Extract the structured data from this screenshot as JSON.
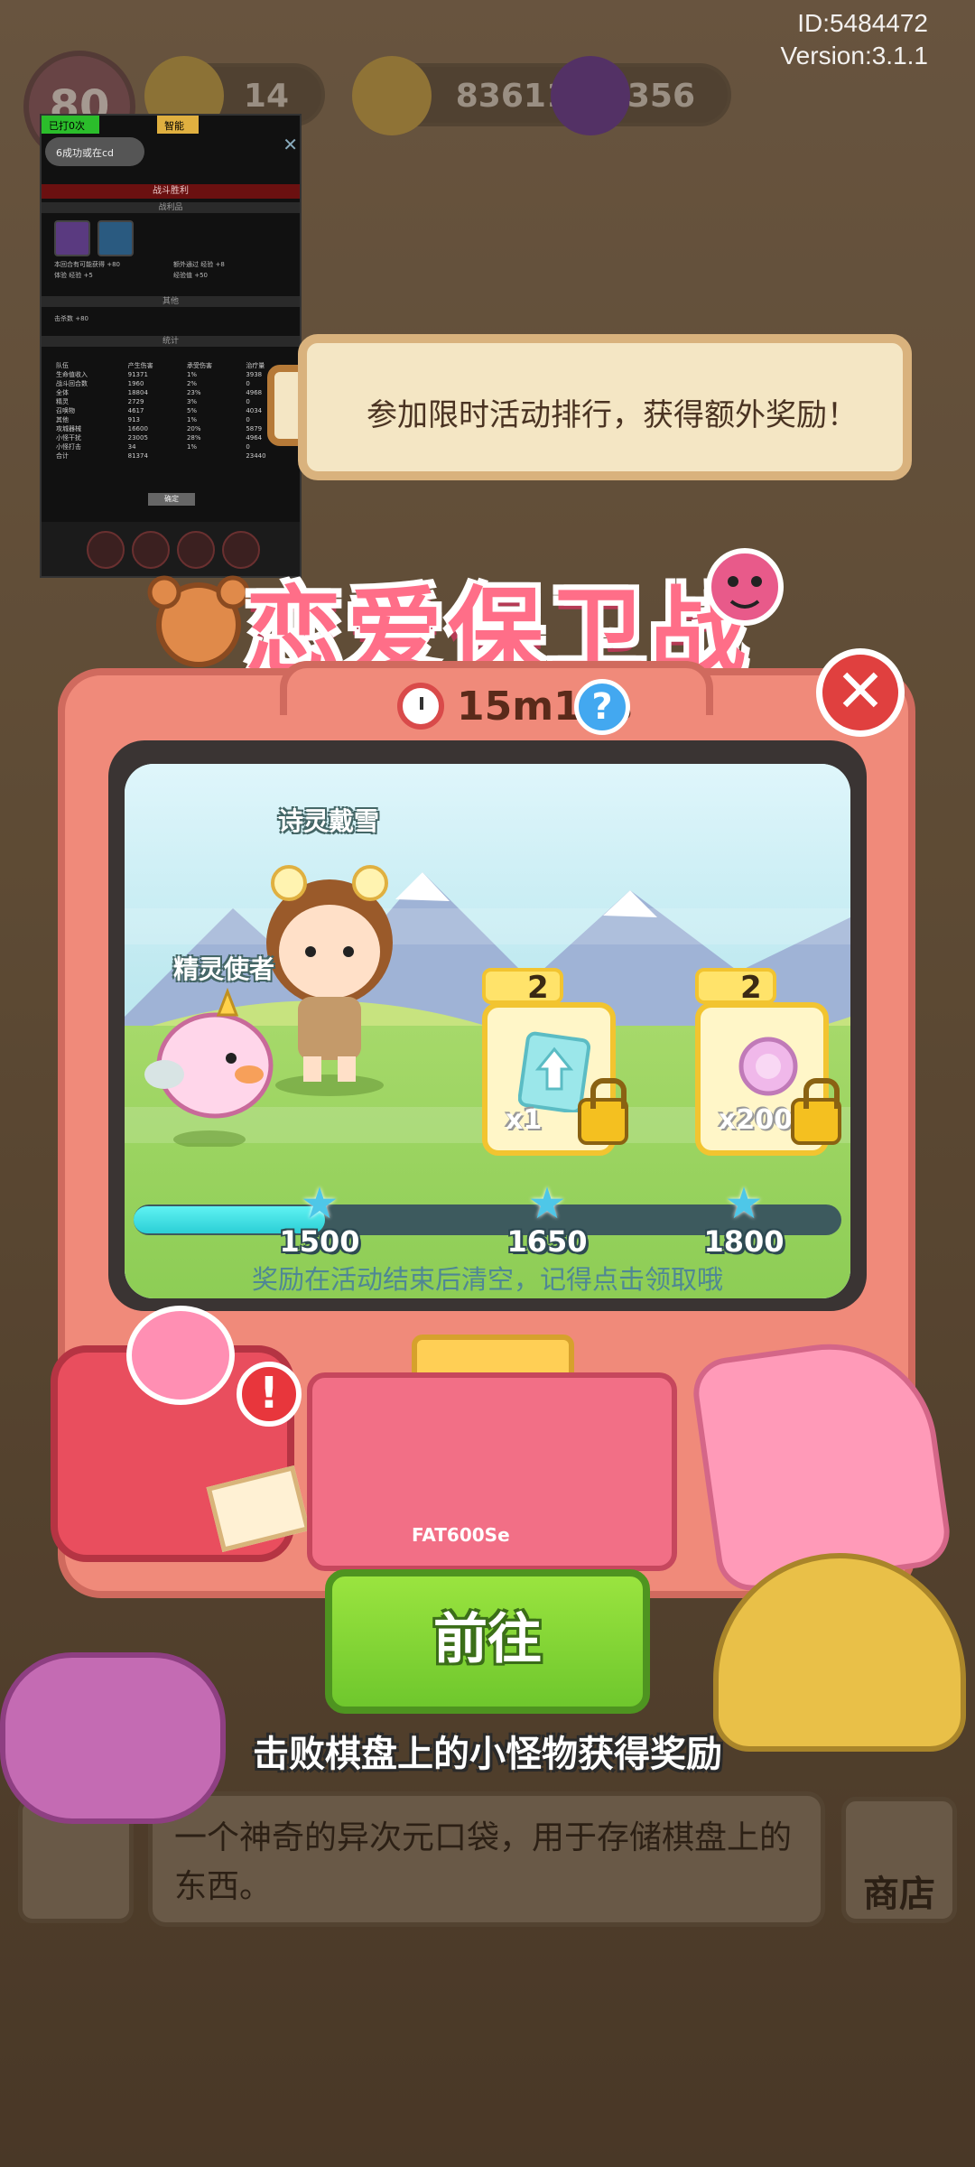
{
  "header": {
    "id_text": "ID:5484472",
    "version_text": "Version:3.1.1",
    "level": "80",
    "resources": [
      {
        "name": "energy",
        "value": "14",
        "icon": "lightning-icon",
        "color": "#e6b93a"
      },
      {
        "name": "gold",
        "value": "83611",
        "icon": "gold-coin-icon",
        "color": "#e6b93a"
      },
      {
        "name": "gems",
        "value": "356",
        "icon": "purple-gem-icon",
        "color": "#7a3fb0"
      }
    ]
  },
  "debug_panel": {
    "tag_attacks": "已打0次",
    "tag_mode": "智能",
    "status_pill": "6成功或在cd",
    "title": "战斗胜利",
    "section_obtained": "战利品",
    "section_other": "其他",
    "section_stats": "统计",
    "line_1": "本回合有可能获得 +80",
    "line_2": "体验 经验 +5",
    "line_3": "额外通过 经验 +8",
    "line_4": "经验值 +50",
    "line_5": "击杀数 +80",
    "table_headers": [
      "队伍",
      "产生伤害",
      "承受伤害",
      "治疗量"
    ],
    "table_rows": [
      [
        "生命值收入",
        "91371",
        "1%",
        "3938"
      ],
      [
        "战斗回合数",
        "1960",
        "2%",
        "0"
      ],
      [
        "全体",
        "18804",
        "23%",
        "4968"
      ],
      [
        "精灵",
        "2729",
        "3%",
        "0"
      ],
      [
        "召唤物",
        "4617",
        "5%",
        "4034"
      ],
      [
        "其他",
        "913",
        "1%",
        "0"
      ],
      [
        "攻城器械",
        "16600",
        "20%",
        "5879"
      ],
      [
        "小怪干扰",
        "23005",
        "28%",
        "4964"
      ],
      [
        "小怪打击",
        "34",
        "1%",
        "0"
      ],
      [
        "合计",
        "81374",
        "",
        "23440"
      ]
    ],
    "confirm_label": "确定"
  },
  "banner": {
    "text": "参加限时活动排行，获得额外奖励！"
  },
  "event": {
    "title": "恋爱保卫战",
    "timer": "15m11s",
    "character_1": "诗灵戴雪",
    "character_2": "精灵使者",
    "rewards": [
      {
        "stars": "2",
        "count": "x1",
        "icon": "upgrade-card-icon"
      },
      {
        "stars": "2",
        "count": "x200",
        "icon": "pink-flower-icon"
      }
    ],
    "progress": 0.27,
    "milestones": [
      "1500",
      "1650",
      "1800"
    ],
    "tip": "奖励在活动结束后清空，记得点击领取哦",
    "console_label": "FAT600Se",
    "go_label": "前往",
    "bottom_hint": "击败棋盘上的小怪物获得奖励"
  },
  "background": {
    "description": "一个神奇的异次元口袋，用于存储棋盘上的东西。",
    "shop_label": "商店"
  },
  "colors": {
    "tv_frame": "#f08a7a",
    "go_button": "#7fd233",
    "progress": "#3fe0e3",
    "title": "#ff6e88"
  }
}
